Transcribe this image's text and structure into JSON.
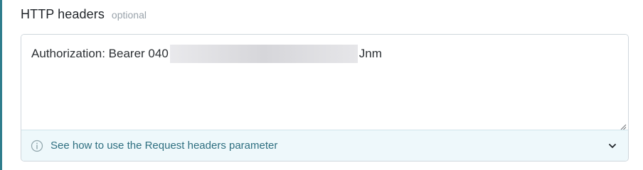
{
  "field": {
    "title": "HTTP headers",
    "optional_label": "optional"
  },
  "textarea": {
    "value_prefix": "Authorization: Bearer 040",
    "value_suffix": "Jnm"
  },
  "help": {
    "text": "See how to use the Request headers parameter"
  },
  "icons": {
    "info": "info-circle-icon",
    "expand": "chevron-down-icon",
    "resize": "resize-grip-icon"
  },
  "colors": {
    "accent": "#2e7d8c",
    "help_background": "#eef8fb",
    "help_text": "#2e6f80"
  }
}
